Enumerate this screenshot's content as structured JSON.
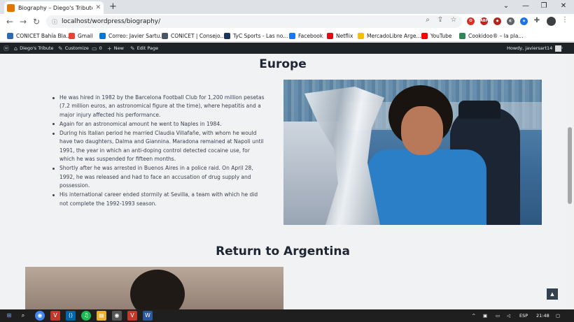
{
  "browser": {
    "tab_title": "Biography – Diego's Tribute",
    "new_tab_glyph": "+",
    "close_glyph": "✕",
    "url": "localhost/wordpress/biography/",
    "window_controls": [
      "⌄",
      "—",
      "❐",
      "✕"
    ]
  },
  "bookmarks": [
    {
      "label": "CONICET Bahía Bla...",
      "color": "#2b6cb0"
    },
    {
      "label": "Gmail",
      "color": "#ea4335"
    },
    {
      "label": "Correo: Javier Sartu...",
      "color": "#0078d4"
    },
    {
      "label": "CONICET | Consejo...",
      "color": "#4a5568"
    },
    {
      "label": "TyC Sports - Las no...",
      "color": "#1a365d"
    },
    {
      "label": "Facebook",
      "color": "#1877f2"
    },
    {
      "label": "Netflix",
      "color": "#e50914"
    },
    {
      "label": "MercadoLibre Arge...",
      "color": "#f6c000"
    },
    {
      "label": "YouTube",
      "color": "#ff0000"
    },
    {
      "label": "Cookidoo® – la pla...",
      "color": "#2f855a"
    }
  ],
  "adminbar": {
    "site_name": "Diego's Tribute",
    "customize": "Customize",
    "comments_count": "0",
    "new": "New",
    "edit_page": "Edit Page",
    "howdy": "Howdy, javiersart14"
  },
  "content": {
    "europe_heading": "Europe",
    "europe_bullets": [
      "He was hired in 1982 by the Barcelona Football Club for 1,200 million pesetas (7.2 million euros, an astronomical figure at the time), where hepatitis and a major injury affected his performance.",
      "Again for an astronomical amount he went to Naples in 1984.",
      "During his Italian period he married Claudia Villafañe, with whom he would have two daughters, Dalma and Giannina. Maradona remained at Napoli until 1991, the year in which an anti-doping control detected cocaine use, for which he was suspended for fifteen months.",
      "Shortly after he was arrested in Buenos Aires in a police raid. On April 28, 1992, he was released and had to face an accusation of drug supply and possession.",
      "His international career ended stormily at Sevilla, a team with which he did not complete the 1992-1993 season."
    ],
    "argentina_heading": "Return to Argentina"
  },
  "taskbar": {
    "lang": "ESP",
    "time": "21:48"
  }
}
